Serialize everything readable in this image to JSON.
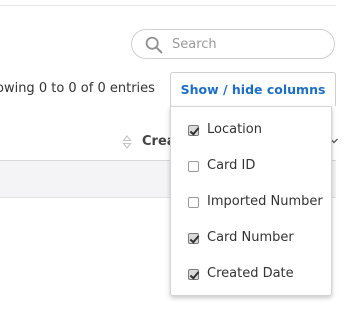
{
  "search": {
    "placeholder": "Search",
    "value": ""
  },
  "table": {
    "entries_info": "owing 0 to 0 of 0 entries",
    "visible_header": "Crea"
  },
  "column_toggle": {
    "button_label": "Show / hide columns",
    "button_color": "#1b6fc9",
    "items": [
      {
        "label": "Location",
        "checked": true
      },
      {
        "label": "Card ID",
        "checked": false
      },
      {
        "label": "Imported Number",
        "checked": false
      },
      {
        "label": "Card Number",
        "checked": true
      },
      {
        "label": "Created Date",
        "checked": true
      }
    ]
  }
}
